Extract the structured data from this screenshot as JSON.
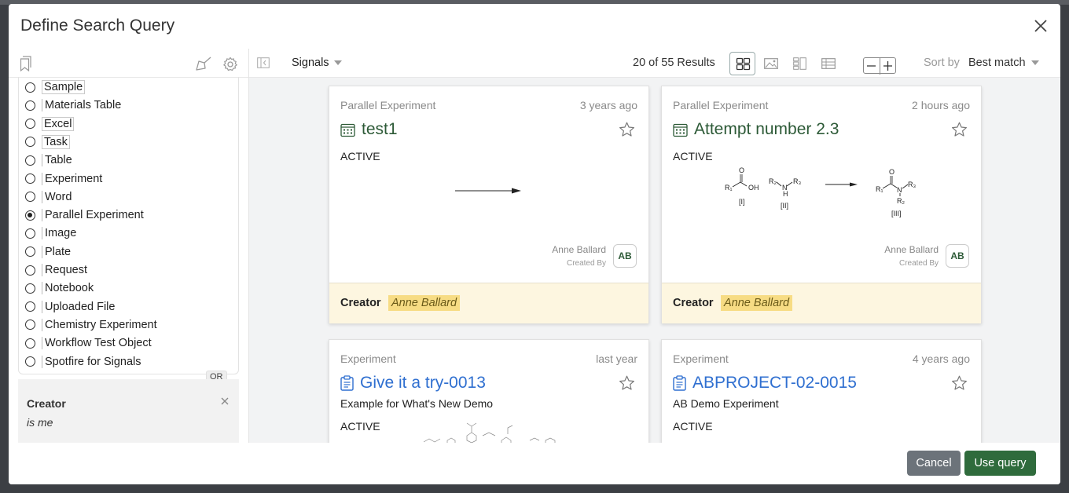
{
  "modal": {
    "title": "Define Search Query"
  },
  "type_list": {
    "items": [
      {
        "label": "Sample",
        "selected": false,
        "boxed": true
      },
      {
        "label": "Materials Table",
        "selected": false,
        "boxed": false
      },
      {
        "label": "Excel",
        "selected": false,
        "boxed": true
      },
      {
        "label": "Task",
        "selected": false,
        "boxed": true
      },
      {
        "label": "Table",
        "selected": false,
        "boxed": false
      },
      {
        "label": "Experiment",
        "selected": false,
        "boxed": false
      },
      {
        "label": "Word",
        "selected": false,
        "boxed": false
      },
      {
        "label": "Parallel Experiment",
        "selected": true,
        "boxed": false
      },
      {
        "label": "Image",
        "selected": false,
        "boxed": false
      },
      {
        "label": "Plate",
        "selected": false,
        "boxed": false
      },
      {
        "label": "Request",
        "selected": false,
        "boxed": false
      },
      {
        "label": "Notebook",
        "selected": false,
        "boxed": false
      },
      {
        "label": "Uploaded File",
        "selected": false,
        "boxed": false
      },
      {
        "label": "Chemistry Experiment",
        "selected": false,
        "boxed": false
      },
      {
        "label": "Workflow Test Object",
        "selected": false,
        "boxed": false
      },
      {
        "label": "Spotfire for Signals",
        "selected": false,
        "boxed": false
      }
    ],
    "or_label": "OR"
  },
  "criteria": {
    "title": "Creator",
    "value": "is me"
  },
  "toolbar": {
    "source": "Signals",
    "results_count": "20 of 55 Results",
    "sort_label": "Sort by",
    "sort_value": "Best match"
  },
  "cards": [
    {
      "type": "Parallel Experiment",
      "time": "3 years ago",
      "title": "test1",
      "status": "ACTIVE",
      "creator_name": "Anne Ballard",
      "created_by": "Created By",
      "initials": "AB",
      "footer_label": "Creator",
      "footer_value": "Anne Ballard"
    },
    {
      "type": "Parallel Experiment",
      "time": "2 hours ago",
      "title": "Attempt number 2.3",
      "status": "ACTIVE",
      "creator_name": "Anne Ballard",
      "created_by": "Created By",
      "initials": "AB",
      "footer_label": "Creator",
      "footer_value": "Anne Ballard",
      "reaction": {
        "r1": "R₁",
        "oh": "OH",
        "o": "O",
        "r2": "R₂",
        "n": "N",
        "h": "H",
        "r3": "R₃",
        "label1": "[I]",
        "label2": "[II]",
        "label3": "[III]"
      }
    },
    {
      "type": "Experiment",
      "time": "last year",
      "title": "Give it a try-0013",
      "description": "Example for What's New Demo",
      "status": "ACTIVE"
    },
    {
      "type": "Experiment",
      "time": "4 years ago",
      "title": "ABPROJECT-02-0015",
      "description": "AB Demo Experiment",
      "status": "ACTIVE"
    }
  ],
  "footer": {
    "cancel": "Cancel",
    "use_query": "Use query"
  },
  "colors": {
    "primary_green": "#2f6b3c",
    "link_blue": "#2f6fd0",
    "highlight": "#f7dc84",
    "card_footer_bg": "#fdf6e0"
  }
}
